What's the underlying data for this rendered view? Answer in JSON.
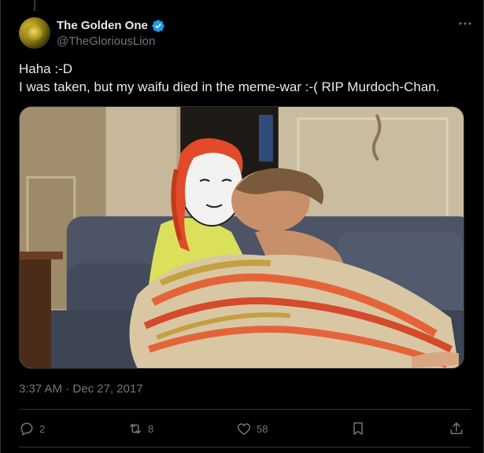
{
  "author": {
    "display_name": "The Golden One",
    "handle": "@TheGloriousLion",
    "verified": true
  },
  "post": {
    "lines": [
      "Haha :-D",
      "I was taken, but my waifu died in the meme-war :-( RIP Murdoch-Chan."
    ]
  },
  "meta": {
    "time": "3:37 AM",
    "separator": "·",
    "date": "Dec 27, 2017"
  },
  "stats": {
    "replies": "2",
    "reposts": "8",
    "likes": "58"
  },
  "icons": {
    "more": "more-horizontal-icon",
    "verified": "verified-badge-icon",
    "reply": "reply-icon",
    "repost": "repost-icon",
    "like": "heart-icon",
    "bookmark": "bookmark-icon",
    "share": "share-icon"
  },
  "colors": {
    "background": "#000000",
    "text": "#e7e9ea",
    "secondary": "#71767b",
    "verified": "#1d9bf0",
    "border": "#2f3336"
  }
}
